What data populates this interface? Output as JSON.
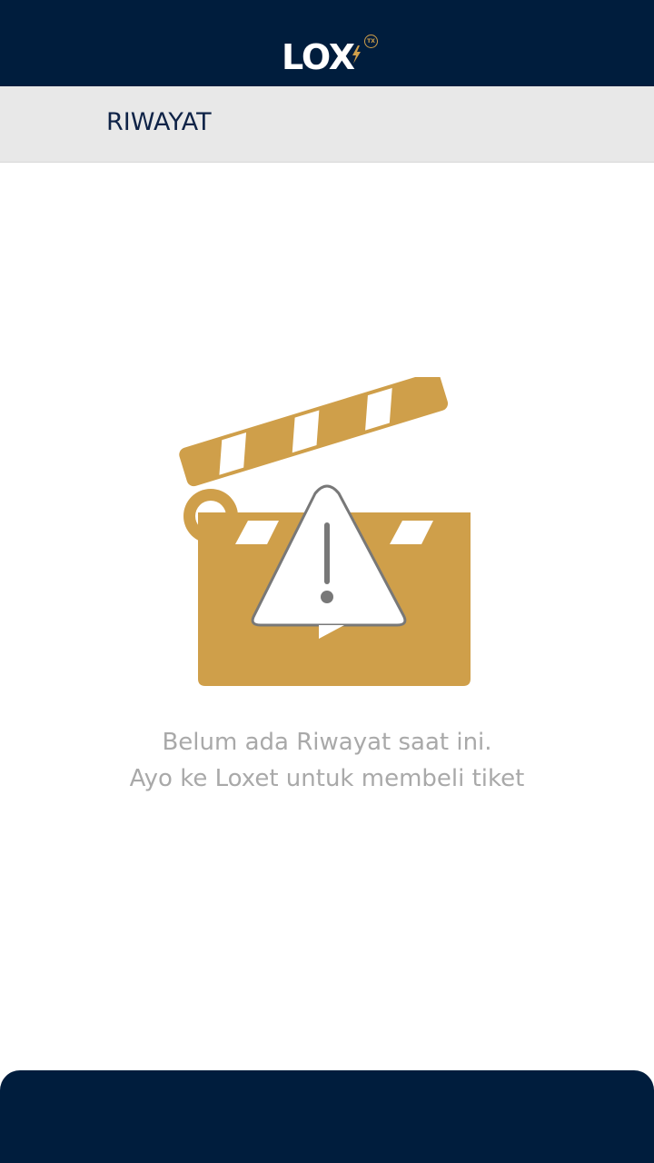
{
  "app": {
    "logo_text": "LOX",
    "logo_badge": "TX"
  },
  "header": {
    "title": "RIWAYAT"
  },
  "empty_state": {
    "icon": "clapperboard-warning-icon",
    "line1": "Belum ada Riwayat saat ini.",
    "line2": "Ayo ke Loxet untuk membeli tiket"
  },
  "colors": {
    "navy": "#001d3d",
    "gold": "#cf9f4a",
    "header_gray": "#e8e8e8",
    "text_gray": "#a9a9a9"
  }
}
